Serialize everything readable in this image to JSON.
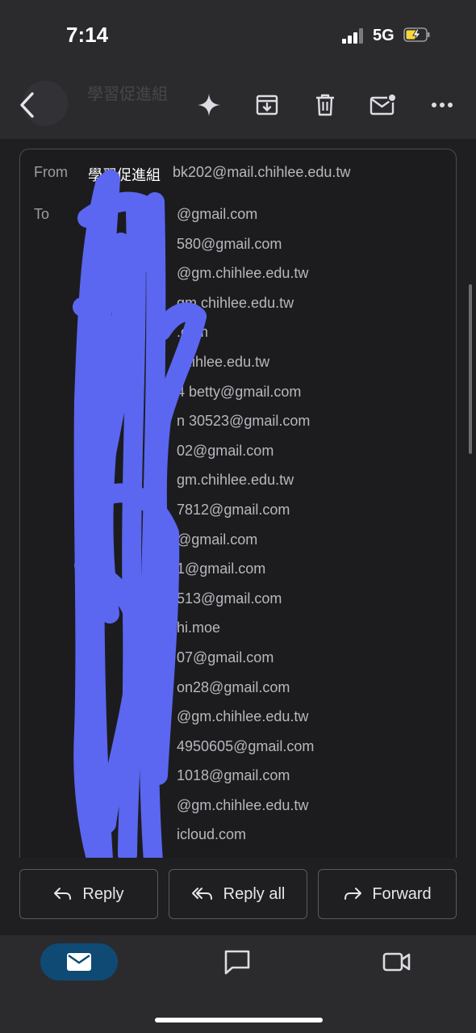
{
  "status": {
    "time": "7:14",
    "network": "5G"
  },
  "header": {
    "sender_hint": "學習促進組"
  },
  "message": {
    "from_label": "From",
    "from_name": "學習促進組",
    "from_email": "bk202@mail.chihlee.edu.tw",
    "to_label": "To",
    "recipients": [
      "@gmail.com",
      "580@gmail.com",
      "@gm.chihlee.edu.tw",
      "gm.chihlee.edu.tw",
      ".com",
      "chihlee.edu.tw",
      "4    betty@gmail.com",
      "n   30523@gmail.com",
      "02@gmail.com",
      "gm.chihlee.edu.tw",
      "7812@gmail.com",
      "@gmail.com",
      "1@gmail.com",
      "513@gmail.com",
      "hi.moe",
      "07@gmail.com",
      "on28@gmail.com",
      "@gm.chihlee.edu.tw",
      "4950605@gmail.com",
      "1018@gmail.com",
      "@gm.chihlee.edu.tw",
      "icloud.com"
    ]
  },
  "actions": {
    "reply": "Reply",
    "reply_all": "Reply all",
    "forward": "Forward"
  },
  "colors": {
    "redaction": "#5b67f0",
    "accent": "#0f4a74"
  }
}
